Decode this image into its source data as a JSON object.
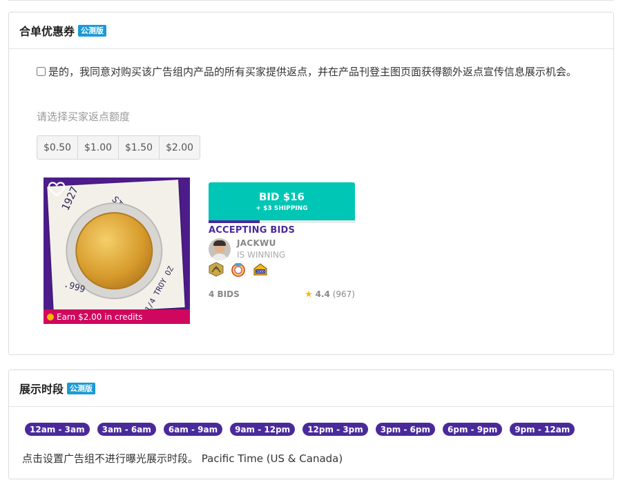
{
  "coupon": {
    "title": "合单优惠券",
    "badge": "公测版",
    "consent_text": "是的，我同意对购买该广告组内产品的所有买家提供返点，并在产品刊登主图页面获得额外返点宣传信息展示机会。",
    "consent_checked": false,
    "amount_label": "请选择买家返点额度",
    "amounts": [
      "$0.50",
      "$1.00",
      "$1.50",
      "$2.00"
    ]
  },
  "listing": {
    "handwriting": {
      "year": "1927",
      "maker": "ST. GAUDENS",
      "weight": "1/4 TROY OZ",
      "purity": ".999"
    },
    "credit_text": "Earn $2.00 in credits",
    "bid_label": "BID $16",
    "shipping_label": "+ $3 SHIPPING",
    "progress": 0.35,
    "status": "ACCEPTING BIDS",
    "winner_name": "JACKWU",
    "winner_status": "IS WINNING",
    "badges": [
      "gold-badge-icon",
      "candy-badge-icon",
      "1000-badge-icon"
    ],
    "bids": "4 BIDS",
    "rating": "4.4",
    "rating_count": "(967)",
    "colors": {
      "bid_button": "#00c6b5",
      "accent": "#4a2a9a",
      "credit_bar": "#d0075e"
    }
  },
  "schedule": {
    "title": "展示时段",
    "badge": "公测版",
    "slots": [
      "12am - 3am",
      "3am - 6am",
      "6am - 9am",
      "9am - 12pm",
      "12pm - 3pm",
      "3pm - 6pm",
      "6pm - 9pm",
      "9pm - 12am"
    ],
    "note": "点击设置广告组不进行曝光展示时段。 Pacific Time (US & Canada)"
  }
}
